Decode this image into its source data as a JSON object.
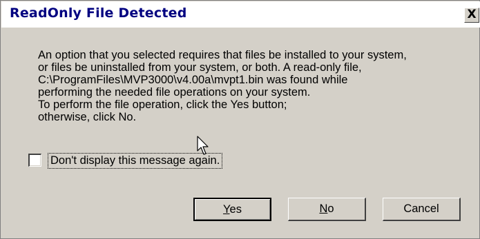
{
  "window": {
    "title": "ReadOnly File Detected",
    "close_glyph": "X"
  },
  "message": {
    "lines": [
      "An option that you selected requires that files be installed to your system,",
      "or files be uninstalled from your system, or both.  A read-only file,",
      "C:\\ProgramFiles\\MVP3000\\v4.00a\\mvpt1.bin was found while",
      "performing the needed file operations on your system.",
      "To perform the file operation, click the Yes button;",
      "otherwise, click No."
    ]
  },
  "checkbox": {
    "label": "Don't display this message again.",
    "checked": false
  },
  "buttons": {
    "yes": {
      "mnemonic": "Y",
      "rest": "es"
    },
    "no": {
      "mnemonic": "N",
      "rest": "o"
    },
    "cancel": {
      "label": "Cancel"
    }
  },
  "icons": {
    "close": "close-icon",
    "cursor": "mouse-pointer-icon"
  },
  "colors": {
    "title_text": "#000080",
    "dialog_bg": "#d4d0c8"
  }
}
